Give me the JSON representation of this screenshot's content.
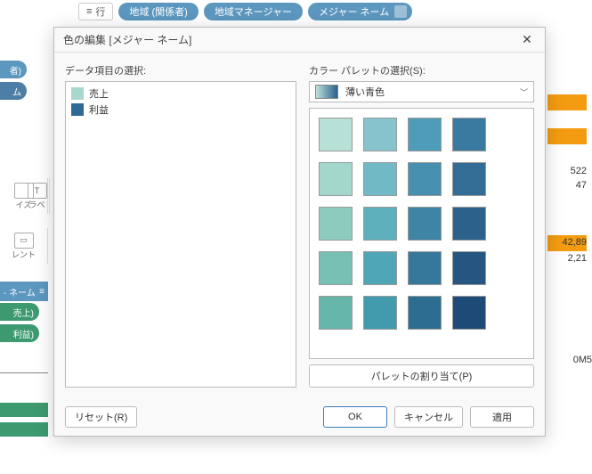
{
  "bg": {
    "row_btn": "行",
    "pills": [
      "地域 (関係者)",
      "地域マネージャー",
      "メジャー ネーム"
    ],
    "left_pill1": "者)",
    "left_pill2": "ム",
    "tool1": "イズ",
    "tool2": "ラベ",
    "tool3": "レント",
    "card": "- ネーム",
    "green_pill1": "売上)",
    "green_pill2": "利益)",
    "right_text1": "522",
    "right_text2": "47",
    "right_text3": "42,89",
    "right_text4": "2,21",
    "right_text5": "0M",
    "right_text6": "5"
  },
  "dialog": {
    "title": "色の編集 [メジャー ネーム]",
    "data_items_label": "データ項目の選択:",
    "palette_select_label": "カラー パレットの選択(S):",
    "palette_name": "薄い青色",
    "items": [
      {
        "label": "売上",
        "color": "#a9d6cd"
      },
      {
        "label": "利益",
        "color": "#2f6a97"
      }
    ],
    "palette_colors": [
      "#b7e0d7",
      "#86c3cc",
      "#4f9cb8",
      "#3a7aa0",
      "#a3d7cb",
      "#71b9c4",
      "#4790af",
      "#336d95",
      "#8dcbbf",
      "#5fb0bd",
      "#3e84a5",
      "#2c618b",
      "#78c0b4",
      "#4fa6b5",
      "#36789b",
      "#255581",
      "#67b6aa",
      "#419bad",
      "#2e6d92",
      "#1e4a77"
    ],
    "assign_btn": "パレットの割り当て(P)",
    "reset_btn": "リセット(R)",
    "ok_btn": "OK",
    "cancel_btn": "キャンセル",
    "apply_btn": "適用"
  }
}
